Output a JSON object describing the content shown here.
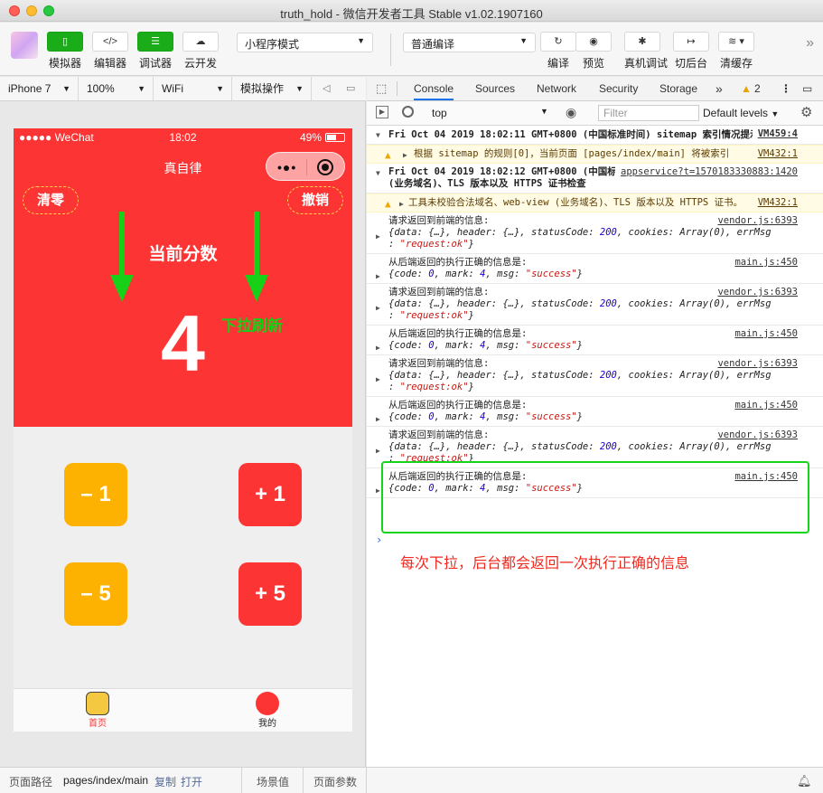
{
  "window": {
    "title": "truth_hold - 微信开发者工具 Stable v1.02.1907160"
  },
  "toolbar": {
    "simulator": "模拟器",
    "editor": "编辑器",
    "debugger": "调试器",
    "cloud": "云开发",
    "mode_select": "小程序模式",
    "compile_select": "普通编译",
    "compile": "编译",
    "preview": "预览",
    "remote_debug": "真机调试",
    "background": "切后台",
    "clear_cache": "清缓存"
  },
  "device_bar": {
    "device": "iPhone 7",
    "zoom": "100%",
    "network": "WiFi",
    "ops": "模拟操作"
  },
  "phone": {
    "carrier": "●●●●● WeChat",
    "time": "18:02",
    "battery": "49%",
    "nav_title": "真自律",
    "clear_btn": "清零",
    "undo_btn": "撤销",
    "score_label": "当前分数",
    "score": "4",
    "pull_note": "下拉刷新",
    "btn_minus1": "– 1",
    "btn_plus1": "+ 1",
    "btn_minus5": "– 5",
    "btn_plus5": "+ 5",
    "tab_home": "首页",
    "tab_mine": "我的",
    "colors": {
      "primary_red": "#fc3434",
      "yellow": "#fdb202",
      "arrow_green": "#18d018"
    }
  },
  "devtools": {
    "tabs": [
      "Console",
      "Sources",
      "Network",
      "Security",
      "Storage"
    ],
    "warn_count": "2",
    "context": "top",
    "filter_placeholder": "Filter",
    "levels": "Default levels",
    "group1_title": "Fri Oct 04 2019 18:02:11 GMT+0800 (中国标准时间) sitemap 索引情况提示",
    "group1_src": "VM459:4",
    "warn1": "根据 sitemap 的规则[0]，当前页面 [pages/index/main] 将被索引",
    "warn1_src": "VM432:1",
    "group2_title": "Fri Oct 04 2019 18:02:12 GMT+0800 (中国标准时间) 配置中关闭合法域名、web-view (业务域名)、TLS 版本以及 HTTPS 证书检查",
    "group2_src": "appservice?t=1570183330883:1420",
    "warn2": "工具未校验合法域名、web-view (业务域名)、TLS 版本以及 HTTPS 证书。",
    "warn2_src": "VM432:1",
    "req_label": "请求返回到前端的信息:",
    "req_src": "vendor.js:6393",
    "req_obj_a": "{data: {…}, header: {…}, statusCode: ",
    "req_status": "200",
    "req_obj_b": ", cookies: Array(0), errMsg",
    "req_obj_c": ": ",
    "req_errmsg": "\"request:ok\"",
    "req_obj_d": "}",
    "res_label": "从后端返回的执行正确的信息是:",
    "res_src": "main.js:450",
    "res_obj_a": "{code: ",
    "res_code": "0",
    "res_obj_b": ", mark: ",
    "res_mark": "4",
    "res_obj_c": ", msg: ",
    "res_msg": "\"success\"",
    "res_obj_d": "}",
    "caption": "每次下拉，后台都会返回一次执行正确的信息"
  },
  "bottom": {
    "path_label": "页面路径",
    "path": "pages/index/main",
    "copy": "复制",
    "open": "打开",
    "scene": "场景值",
    "params": "页面参数"
  }
}
